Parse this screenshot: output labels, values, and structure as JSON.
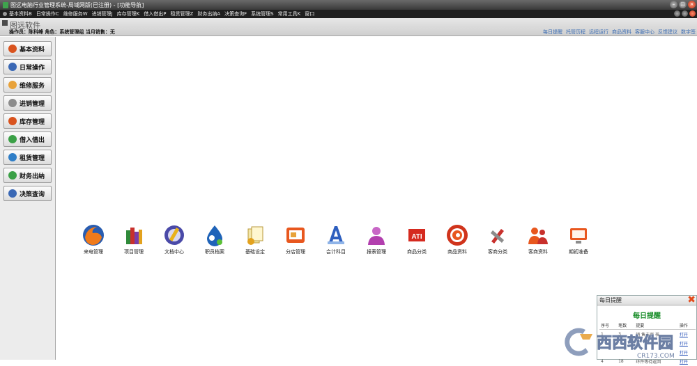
{
  "window": {
    "title": "图远电脑行业管理系统-局域网版(已注册) - [功能导航]"
  },
  "menu": [
    "基本资料B",
    "日常操作C",
    "维修服务W",
    "进销管理J",
    "库存管理K",
    "借入借出P",
    "租赁管理Z",
    "财务出纳A",
    "决策查询F",
    "系统管理S",
    "常用工具K",
    "窗口"
  ],
  "brand": {
    "name": "图远软件",
    "operator": "操作员：陈科峰  角色：系统管理组  当月销售：无"
  },
  "quicklinks": [
    "每日提醒",
    "托管历程",
    "远程运行",
    "商品资料",
    "客服中心",
    "反馈建议",
    "数字签"
  ],
  "sidebar": [
    {
      "label": "基本资料",
      "color": "#d9531e"
    },
    {
      "label": "日常操作",
      "color": "#3a68b5"
    },
    {
      "label": "维修服务",
      "color": "#e8a23a"
    },
    {
      "label": "进销管理",
      "color": "#8c8c8c"
    },
    {
      "label": "库存管理",
      "color": "#d9531e"
    },
    {
      "label": "借入借出",
      "color": "#3aa046"
    },
    {
      "label": "租赁管理",
      "color": "#2f7ec7"
    },
    {
      "label": "财务出纳",
      "color": "#3aa046"
    },
    {
      "label": "决策查询",
      "color": "#3a68b5"
    }
  ],
  "modules": [
    {
      "label": "来电管理",
      "icon": "firefox-icon"
    },
    {
      "label": "项目管理",
      "icon": "books-icon"
    },
    {
      "label": "文档中心",
      "icon": "pencil-disc-icon"
    },
    {
      "label": "职员档案",
      "icon": "droplet-icon"
    },
    {
      "label": "基础设定",
      "icon": "papers-icon"
    },
    {
      "label": "分店管理",
      "icon": "slideshow-icon"
    },
    {
      "label": "会计科目",
      "icon": "letter-a-icon"
    },
    {
      "label": "报表管理",
      "icon": "person-icon"
    },
    {
      "label": "商品分类",
      "icon": "ati-icon"
    },
    {
      "label": "商品资料",
      "icon": "spiral-icon"
    },
    {
      "label": "客商分类",
      "icon": "tools-icon"
    },
    {
      "label": "客商资料",
      "icon": "people-icon"
    },
    {
      "label": "期初准备",
      "icon": "monitor-icon"
    }
  ],
  "reminder": {
    "header": "每日提醒",
    "title": "每日提醒",
    "columns": [
      "序号",
      "笔数",
      "提要",
      "操作"
    ],
    "rows": [
      {
        "no": "1",
        "count": "3",
        "summary": "销 售未审 核",
        "op": "打开"
      },
      {
        "no": "",
        "count": "",
        "summary": "",
        "op": "打开"
      },
      {
        "no": "",
        "count": "",
        "summary": "",
        "op": "打开"
      },
      {
        "no": "4",
        "count": "18",
        "summary": "环件等待返回",
        "op": "打开"
      }
    ]
  },
  "watermark": {
    "text1": "西西软件园",
    "text2": "CR173.COM"
  }
}
